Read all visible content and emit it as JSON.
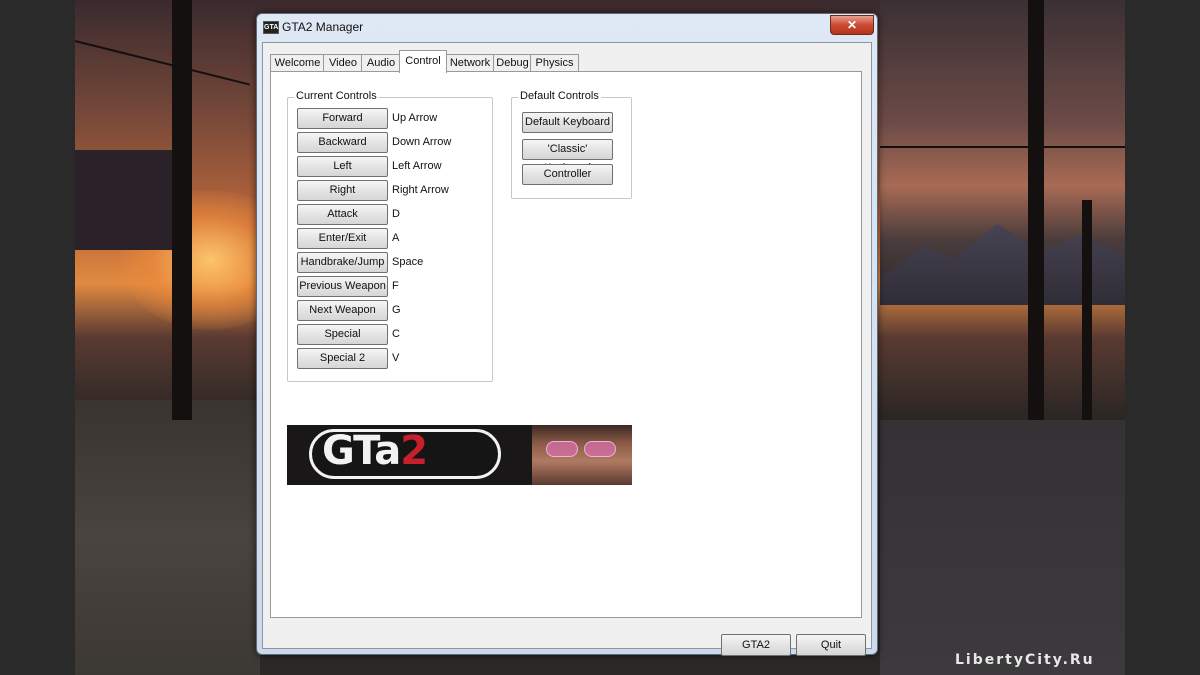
{
  "window": {
    "title": "GTA2 Manager",
    "app_icon_text": "GTA",
    "close_glyph": "✕"
  },
  "tabs": [
    {
      "label": "Welcome"
    },
    {
      "label": "Video"
    },
    {
      "label": "Audio"
    },
    {
      "label": "Control",
      "active": true
    },
    {
      "label": "Network"
    },
    {
      "label": "Debug"
    },
    {
      "label": "Physics"
    }
  ],
  "current_controls": {
    "title": "Current Controls",
    "items": [
      {
        "action": "Forward",
        "key": "Up Arrow"
      },
      {
        "action": "Backward",
        "key": "Down Arrow"
      },
      {
        "action": "Left",
        "key": "Left Arrow"
      },
      {
        "action": "Right",
        "key": "Right Arrow"
      },
      {
        "action": "Attack",
        "key": "D"
      },
      {
        "action": "Enter/Exit",
        "key": "A"
      },
      {
        "action": "Handbrake/Jump",
        "key": "Space"
      },
      {
        "action": "Previous Weapon",
        "key": "F"
      },
      {
        "action": "Next Weapon",
        "key": "G"
      },
      {
        "action": "Special",
        "key": "C"
      },
      {
        "action": "Special 2",
        "key": "V"
      }
    ]
  },
  "default_controls": {
    "title": "Default Controls",
    "buttons": [
      "Default Keyboard",
      "'Classic' Keyboard",
      "Controller"
    ]
  },
  "banner": {
    "logo_main": "GTa",
    "logo_num": "2"
  },
  "footer": {
    "gta2_label": "GTA2",
    "quit_label": "Quit"
  },
  "watermark": "LibertyCity.Ru",
  "colors": {
    "accent_red": "#c8202a",
    "panel_bg": "#ffffff",
    "dialog_bg": "#f0f0f0"
  }
}
